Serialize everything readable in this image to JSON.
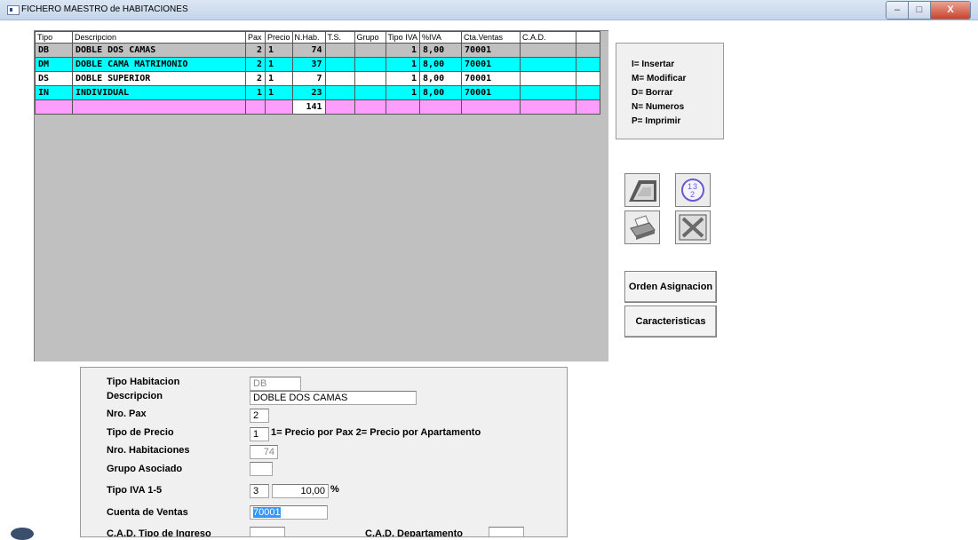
{
  "window": {
    "title": "FICHERO MAESTRO de HABITACIONES",
    "buttons": {
      "minimize": "–",
      "maximize": "□",
      "close": "X"
    }
  },
  "grid": {
    "columns": [
      "Tipo",
      "Descripcion",
      "Pax",
      "Precio",
      "N.Hab.",
      "T.S.",
      "Grupo",
      "Tipo IVA",
      "%IVA",
      "Cta.Ventas",
      "C.A.D."
    ],
    "rows": [
      {
        "tipo": "DB",
        "descripcion": "DOBLE DOS CAMAS",
        "pax": "2",
        "precio": "1",
        "nhab": "74",
        "ts": "",
        "grupo": "",
        "tipoiva": "1",
        "iva": "8,00",
        "cta": "70001",
        "cad": ""
      },
      {
        "tipo": "DM",
        "descripcion": "DOBLE CAMA MATRIMONIO",
        "pax": "2",
        "precio": "1",
        "nhab": "37",
        "ts": "",
        "grupo": "",
        "tipoiva": "1",
        "iva": "8,00",
        "cta": "70001",
        "cad": ""
      },
      {
        "tipo": "DS",
        "descripcion": "DOBLE SUPERIOR",
        "pax": "2",
        "precio": "1",
        "nhab": "7",
        "ts": "",
        "grupo": "",
        "tipoiva": "1",
        "iva": "8,00",
        "cta": "70001",
        "cad": ""
      },
      {
        "tipo": "IN",
        "descripcion": "INDIVIDUAL",
        "pax": "1",
        "precio": "1",
        "nhab": "23",
        "ts": "",
        "grupo": "",
        "tipoiva": "1",
        "iva": "8,00",
        "cta": "70001",
        "cad": ""
      }
    ],
    "total_hab": "141"
  },
  "legend": [
    "I= Insertar",
    "M= Modificar",
    "D= Borrar",
    "N= Numeros",
    "P= Imprimir"
  ],
  "icons": {
    "keyboard": "keyboard-icon",
    "numbers": "numbers-icon",
    "printer": "printer-icon",
    "excel": "excel-icon"
  },
  "buttons": {
    "orden": "Orden Asignacion",
    "caracteristicas": "Caracteristicas"
  },
  "form": {
    "tipo_habitacion": {
      "label": "Tipo Habitacion",
      "value": "DB"
    },
    "descripcion": {
      "label": "Descripcion",
      "value": "DOBLE DOS CAMAS"
    },
    "nro_pax": {
      "label": "Nro. Pax",
      "value": "2"
    },
    "tipo_precio": {
      "label": "Tipo de Precio",
      "value": "1",
      "note": "1= Precio por Pax  2= Precio por Apartamento"
    },
    "nro_habitaciones": {
      "label": "Nro. Habitaciones",
      "value": "74"
    },
    "grupo_asociado": {
      "label": "Grupo Asociado",
      "value": ""
    },
    "tipo_iva": {
      "label": "Tipo IVA 1-5",
      "value": "3",
      "percent": "10,00",
      "unit": "%"
    },
    "cuenta_ventas": {
      "label": "Cuenta de Ventas",
      "value": "70001"
    },
    "cad_tipo_ingreso": {
      "label": "C.A.D. Tipo de Ingreso",
      "value": ""
    },
    "cad_departamento": {
      "label": "C.A.D. Departamento",
      "value": ""
    }
  },
  "colors": {
    "row_cyan": "#00ffff",
    "row_total": "#ff9cff",
    "grid_background": "#c0c0c0",
    "selection": "#3399ff"
  }
}
